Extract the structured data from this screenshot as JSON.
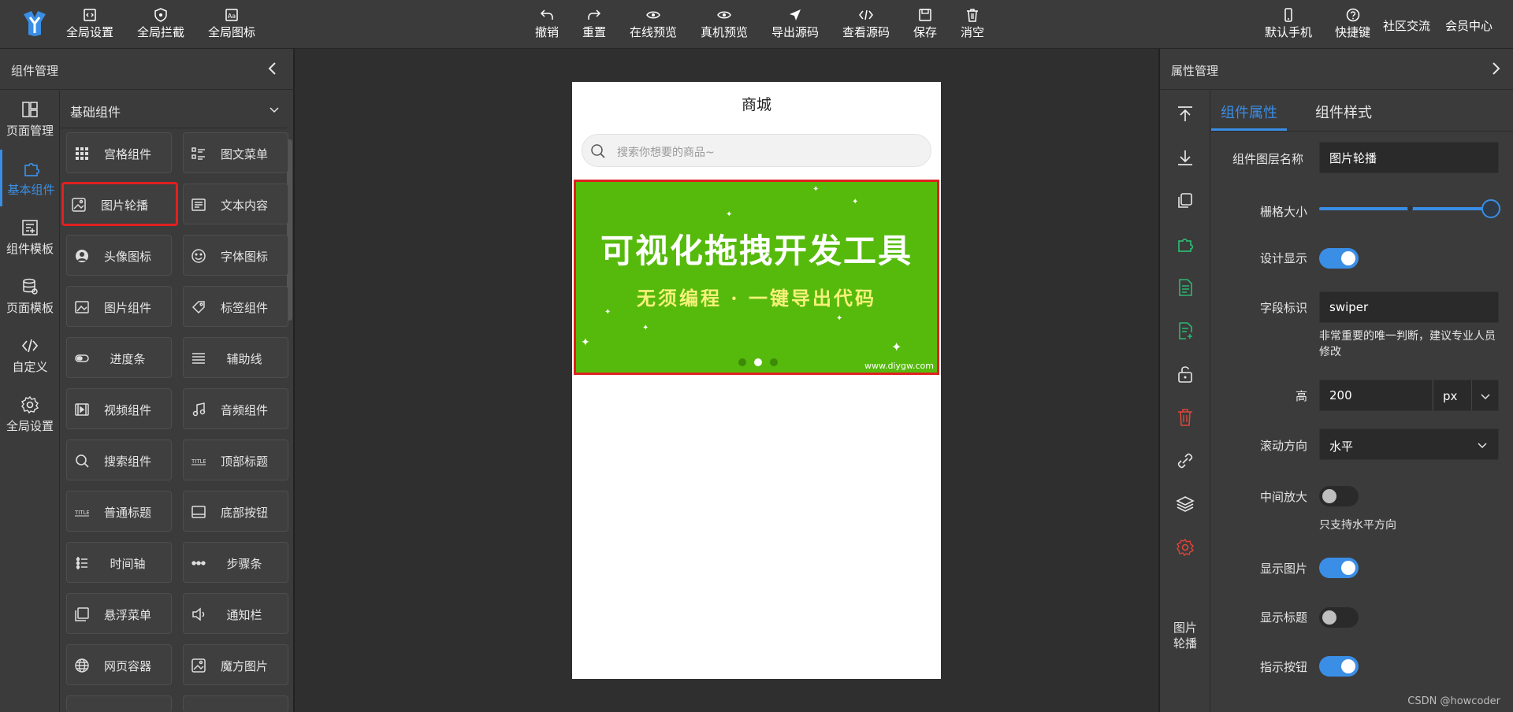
{
  "toolbar": {
    "left": [
      {
        "label": "全局设置",
        "icon": "code-file-icon"
      },
      {
        "label": "全局拦截",
        "icon": "shield-icon"
      },
      {
        "label": "全局图标",
        "icon": "font-icon"
      }
    ],
    "center": [
      {
        "label": "撤销",
        "icon": "undo-icon"
      },
      {
        "label": "重置",
        "icon": "redo-icon"
      },
      {
        "label": "在线预览",
        "icon": "eye-icon"
      },
      {
        "label": "真机预览",
        "icon": "eye-icon"
      },
      {
        "label": "导出源码",
        "icon": "send-icon"
      },
      {
        "label": "查看源码",
        "icon": "code-icon"
      },
      {
        "label": "保存",
        "icon": "save-icon"
      },
      {
        "label": "消空",
        "icon": "trash-icon"
      }
    ],
    "right": [
      {
        "label": "默认手机",
        "icon": "phone-icon"
      },
      {
        "label": "快捷键",
        "icon": "help-icon"
      }
    ],
    "links": [
      "社区交流",
      "会员中心"
    ]
  },
  "left_panel": {
    "title": "组件管理",
    "nav": [
      {
        "label": "页面管理",
        "icon": "layout-icon"
      },
      {
        "label": "基本组件",
        "icon": "puzzle-icon",
        "active": true
      },
      {
        "label": "组件模板",
        "icon": "template-icon"
      },
      {
        "label": "页面模板",
        "icon": "database-icon"
      },
      {
        "label": "自定义",
        "icon": "code-icon"
      },
      {
        "label": "全局设置",
        "icon": "gear-icon"
      }
    ],
    "section_title": "基础组件",
    "components": [
      [
        "宫格组件",
        "图文菜单"
      ],
      [
        "图片轮播",
        "文本内容"
      ],
      [
        "头像图标",
        "字体图标"
      ],
      [
        "图片组件",
        "标签组件"
      ],
      [
        "进度条",
        "辅助线"
      ],
      [
        "视频组件",
        "音频组件"
      ],
      [
        "搜索组件",
        "顶部标题"
      ],
      [
        "普通标题",
        "底部按钮"
      ],
      [
        "时间轴",
        "步骤条"
      ],
      [
        "悬浮菜单",
        "通知栏"
      ],
      [
        "网页容器",
        "魔方图片"
      ]
    ],
    "selected": "图片轮播"
  },
  "phone": {
    "title": "商城",
    "search_placeholder": "搜索你想要的商品~",
    "banner": {
      "headline": "可视化拖拽开发工具",
      "subline": "无须编程 · 一键导出代码",
      "watermark": "www.diygw.com",
      "bg_color": "#56ba0c",
      "active_dot": 2,
      "dot_count": 3
    }
  },
  "right_panel": {
    "title": "属性管理",
    "tools": [
      "move-top-icon",
      "move-bottom-icon",
      "copy-icon",
      "puzzle-icon",
      "document-icon",
      "document-add-icon",
      "unlock-icon",
      "trash-icon",
      "link-icon",
      "layers-icon",
      "gear-icon"
    ],
    "component_name": "图片\n轮播",
    "tabs": [
      "组件属性",
      "组件样式"
    ],
    "active_tab": "组件属性",
    "fields": {
      "layer_name_label": "组件图层名称",
      "layer_name_value": "图片轮播",
      "grid_label": "栅格大小",
      "grid_value": 24,
      "grid_max": 24,
      "design_show_label": "设计显示",
      "design_show": true,
      "field_id_label": "字段标识",
      "field_id_value": "swiper",
      "field_id_help": "非常重要的唯一判断，建议专业人员修改",
      "height_label": "高",
      "height_value": "200",
      "height_unit": "px",
      "scroll_label": "滚动方向",
      "scroll_value": "水平",
      "zoom_label": "中间放大",
      "zoom": false,
      "zoom_help": "只支持水平方向",
      "show_image_label": "显示图片",
      "show_image": true,
      "show_title_label": "显示标题",
      "show_title": false,
      "indicator_label": "指示按钮",
      "indicator": true
    }
  },
  "watermark": "CSDN @howcoder"
}
